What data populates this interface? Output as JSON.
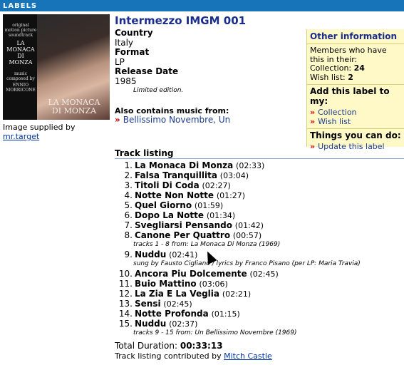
{
  "header": {
    "section_title": "Labels"
  },
  "cover": {
    "small_top": "original motion picture soundtrack",
    "title_small_lines": [
      "LA",
      "MONACA",
      "DI",
      "MONZA"
    ],
    "music_line": "music composed by",
    "composer": "ENNIO MORRICONE",
    "title_big_lines": [
      "LA MONACA",
      "DI MONZA"
    ]
  },
  "image_credit": {
    "label": "Image supplied by",
    "user": "mr.target"
  },
  "release": {
    "title": "Intermezzo IMGM 001",
    "country_label": "Country",
    "country": "Italy",
    "format_label": "Format",
    "format": "LP",
    "date_label": "Release Date",
    "date": "1985",
    "note": "Limited edition."
  },
  "also": {
    "label": "Also contains music from:",
    "link": "Bellissimo Novembre, Un"
  },
  "sidebar": {
    "other_info_title": "Other information",
    "members_text": "Members who have this in their:",
    "collection_label": "Collection:",
    "collection_count": "24",
    "wishlist_label": "Wish list:",
    "wishlist_count": "2",
    "add_title": "Add this label to my:",
    "add_collection": "Collection",
    "add_wishlist": "Wish list",
    "things_title": "Things you can do:",
    "update_link": "Update this label"
  },
  "tracklisting": {
    "title": "Track listing",
    "tracks": [
      {
        "n": "1.",
        "name": "La Monaca Di Monza",
        "dur": "(02:33)"
      },
      {
        "n": "2.",
        "name": "Falsa Tranquillita",
        "dur": "(03:04)"
      },
      {
        "n": "3.",
        "name": "Titoli Di Coda",
        "dur": "(02:27)"
      },
      {
        "n": "4.",
        "name": "Notte Non Notte",
        "dur": "(01:27)"
      },
      {
        "n": "5.",
        "name": "Quel Giorno",
        "dur": "(01:59)"
      },
      {
        "n": "6.",
        "name": "Dopo La Notte",
        "dur": "(01:34)"
      },
      {
        "n": "7.",
        "name": "Svegliarsi Pensando",
        "dur": "(01:42)"
      },
      {
        "n": "8.",
        "name": "Canone Per Quattro",
        "dur": "(00:57)"
      },
      {
        "n": "9.",
        "name": "Nuddu",
        "dur": "(02:41)"
      },
      {
        "n": "10.",
        "name": "Ancora Piu Dolcemente",
        "dur": "(02:45)"
      },
      {
        "n": "11.",
        "name": "Buio Mattino",
        "dur": "(03:06)"
      },
      {
        "n": "12.",
        "name": "La Zia E La Veglia",
        "dur": "(02:21)"
      },
      {
        "n": "13.",
        "name": "Sensi",
        "dur": "(02:45)"
      },
      {
        "n": "14.",
        "name": "Notte Profonda",
        "dur": "(01:15)"
      },
      {
        "n": "15.",
        "name": "Nuddu",
        "dur": "(02:37)"
      }
    ],
    "note_1_8": "tracks 1 - 8 from: La Monaca Di Monza (1969)",
    "note_9": "sung by Fausto Cigliano / lyrics by Franco Pisano (per LP: Maria Travia)",
    "note_9_15": "tracks 9 - 15 from: Un Bellissimo Novembre (1969)",
    "total_label": "Total Duration:",
    "total_value": "00:33:13",
    "contrib_label": "Track listing contributed by",
    "contrib_user": "Mitch Castle"
  }
}
